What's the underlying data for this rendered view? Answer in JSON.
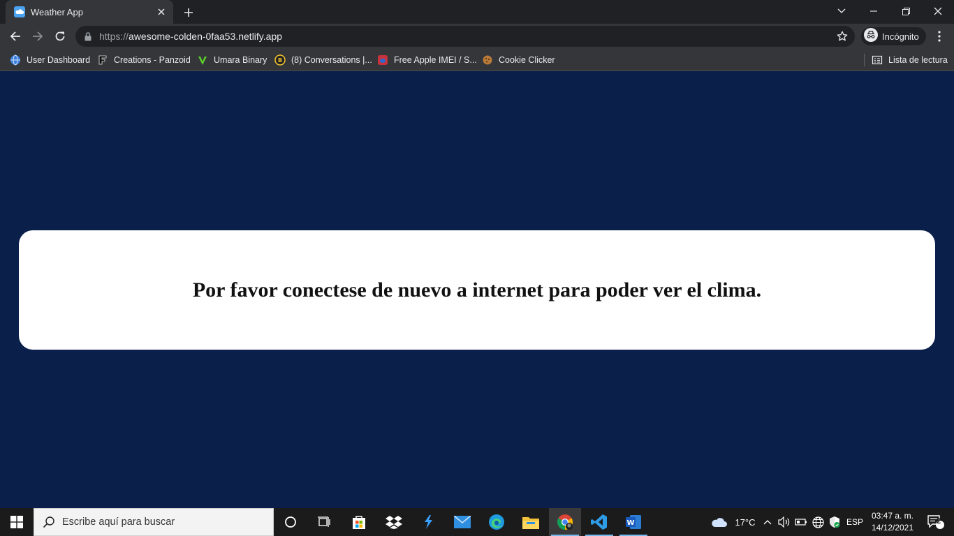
{
  "browser": {
    "tab": {
      "title": "Weather App"
    },
    "omnibox": {
      "scheme": "https://",
      "host": "awesome-colden-0faa53.netlify.app"
    },
    "profile_label": "Incógnito",
    "bookmarks": [
      {
        "label": "User Dashboard"
      },
      {
        "label": "Creations - Panzoid"
      },
      {
        "label": "Umara Binary"
      },
      {
        "label": "(8) Conversations |..."
      },
      {
        "label": "Free Apple IMEI / S..."
      },
      {
        "label": "Cookie Clicker"
      }
    ],
    "reading_list_label": "Lista de lectura"
  },
  "page": {
    "message": "Por favor conectese de nuevo a internet para poder ver el clima.",
    "background_color": "#0b1f4b",
    "card_color": "#ffffff"
  },
  "taskbar": {
    "search_placeholder": "Escribe aquí para buscar",
    "weather_temp": "17°C",
    "language": "ESP",
    "time": "03:47 a. m.",
    "date": "14/12/2021",
    "notification_count": "2"
  }
}
